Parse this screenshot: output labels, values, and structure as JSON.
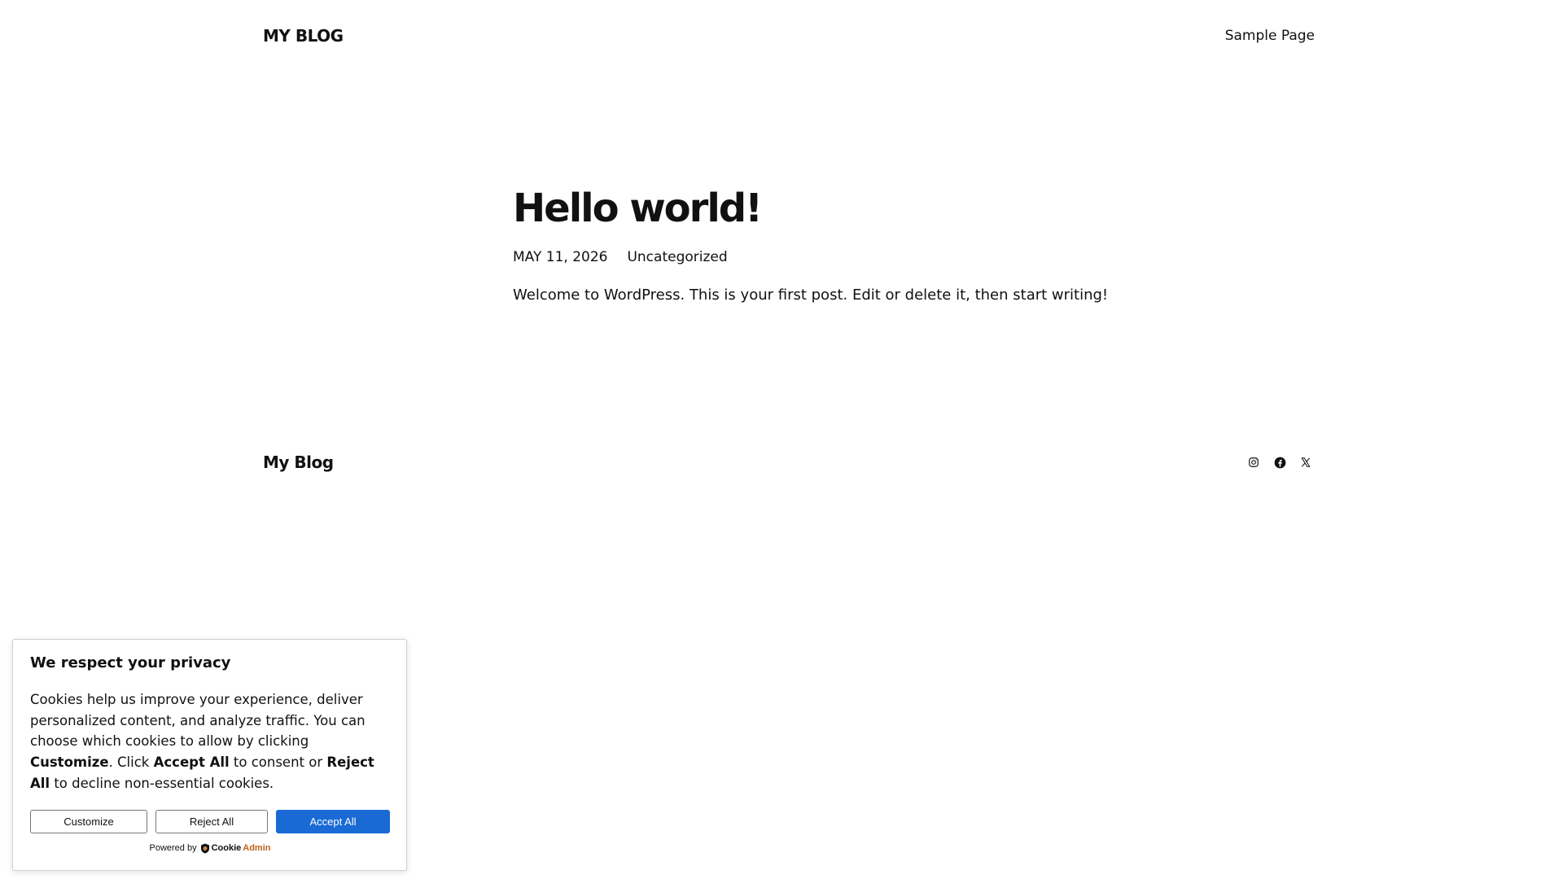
{
  "header": {
    "site_title": "MY BLOG",
    "nav": {
      "sample_page": "Sample Page"
    }
  },
  "post": {
    "title": "Hello world!",
    "date": "MAY 11, 2026",
    "category": "Uncategorized",
    "content": "Welcome to WordPress. This is your first post. Edit or delete it, then start writing!"
  },
  "footer": {
    "site_title": "My Blog",
    "social": [
      "instagram-icon",
      "facebook-icon",
      "x-icon"
    ]
  },
  "cookie_banner": {
    "title": "We respect your privacy",
    "text": {
      "part1": "Cookies help us improve your experience, deliver personalized content, and analyze traffic. You can choose which cookies to allow by clicking ",
      "customize_bold": "Customize",
      "part2": ". Click ",
      "accept_bold": "Accept All",
      "part3": " to consent or ",
      "reject_bold": "Reject All",
      "part4": " to decline non-essential cookies."
    },
    "buttons": {
      "customize": "Customize",
      "reject": "Reject All",
      "accept": "Accept All"
    },
    "powered_by": "Powered by",
    "brand": {
      "part1": "Cookie",
      "part2": "Admin"
    },
    "colors": {
      "accept_bg": "#1a6ad6",
      "brand_accent": "#c0631a"
    }
  }
}
